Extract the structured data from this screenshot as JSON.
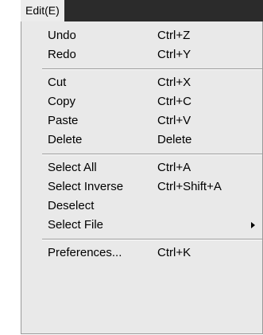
{
  "menu": {
    "title": "Edit(E)",
    "items": [
      {
        "label": "Undo",
        "shortcut": "Ctrl+Z"
      },
      {
        "label": "Redo",
        "shortcut": "Ctrl+Y"
      },
      {
        "label": "Cut",
        "shortcut": "Ctrl+X"
      },
      {
        "label": "Copy",
        "shortcut": "Ctrl+C"
      },
      {
        "label": "Paste",
        "shortcut": "Ctrl+V"
      },
      {
        "label": "Delete",
        "shortcut": "Delete"
      },
      {
        "label": "Select All",
        "shortcut": "Ctrl+A"
      },
      {
        "label": "Select Inverse",
        "shortcut": "Ctrl+Shift+A"
      },
      {
        "label": "Deselect",
        "shortcut": ""
      },
      {
        "label": "Select File",
        "shortcut": "",
        "submenu_icon": "chevron-right-icon"
      },
      {
        "label": "Preferences...",
        "shortcut": "Ctrl+K"
      }
    ]
  },
  "colors": {
    "menubar_background": "#2b2b2b",
    "menu_title_background": "#ececec",
    "menu_background": "#e9e9e9",
    "text": "#000000",
    "separator": "#9b9b9b"
  }
}
